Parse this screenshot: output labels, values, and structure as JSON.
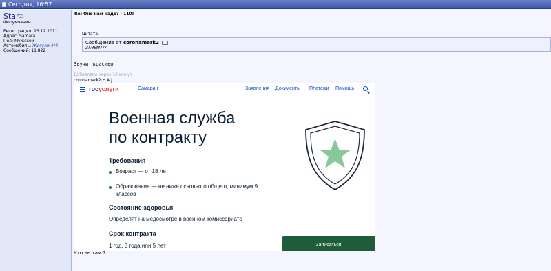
{
  "topbar": {
    "date": "Сегодня, 16:57"
  },
  "user": {
    "name": "Star",
    "rank": "Форумчанин",
    "info": [
      {
        "label": "Регистрация:",
        "value": "23.12.2011"
      },
      {
        "label": "Адрес:",
        "value": "Samara"
      },
      {
        "label": "Пол:",
        "value": "Мужской"
      },
      {
        "label": "Автомобиль:",
        "value": "Жигули 4*4"
      },
      {
        "label": "Сообщений:",
        "value": "11,822"
      }
    ]
  },
  "post": {
    "title": "Re: Оно нам надо? - 110!",
    "quote_label": "Цитата:",
    "quote_from": "Сообщение от",
    "quote_author": "coronamark2",
    "quote_text": "ЗАЧЕМ???",
    "reply1": "Звучит красиво.",
    "added_note": "Добавлено через 10 минут",
    "signature_line": "coronamark2 Н.А.J",
    "reply2": "Что не там ?"
  },
  "embed": {
    "logo_left": "гос",
    "logo_right": "услуги",
    "city": "Самара г",
    "nav": [
      "Заявления",
      "Документы",
      "Платежи",
      "Помощь"
    ],
    "title_line1": "Военная служба",
    "title_line2": "по контракту",
    "req_heading": "Требования",
    "req_items": [
      "Возраст — от 18 лет",
      "Образование — не ниже основного общего, минимум 9",
      "классов"
    ],
    "health_heading": "Состояние здоровья",
    "health_text": "Определят на медосмотре в военном комиссариате",
    "contract_heading": "Срок контракта",
    "contract_text": "1 год, 3 года или 5 лет",
    "button": "Записаться",
    "colors": {
      "brand": "#0d4cd3",
      "accent_red": "#e73d3d",
      "button": "#1e5c3a"
    }
  }
}
